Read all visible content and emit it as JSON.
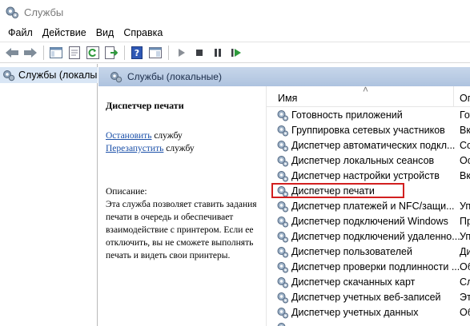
{
  "window": {
    "title": "Службы",
    "icon": "gears-icon"
  },
  "menu": [
    "Файл",
    "Действие",
    "Вид",
    "Справка"
  ],
  "toolbar": {
    "buttons": [
      "back-icon",
      "forward-icon",
      "console-tree-icon",
      "properties-icon",
      "refresh-icon",
      "export-icon",
      "help-icon",
      "view-icon",
      "start-icon",
      "stop-icon",
      "pause-icon",
      "restart-icon"
    ]
  },
  "tree": {
    "label": "Службы (локалы"
  },
  "pane_header": {
    "label": "Службы (локальные)"
  },
  "details": {
    "service_name": "Диспетчер печати",
    "stop_link": "Остановить",
    "stop_suffix": " службу",
    "restart_link": "Перезапустить",
    "restart_suffix": " службу",
    "description_label": "Описание:",
    "description_text": "Эта служба позволяет ставить задания печати в очередь и обеспечивает взаимодействие с принтером. Если ее отключить, вы не сможете выполнять печать и видеть свои принтеры."
  },
  "list": {
    "columns": {
      "name": "Имя",
      "desc": "Оп"
    },
    "rows": [
      {
        "name": "Готовность приложений",
        "d": "Гот"
      },
      {
        "name": "Группировка сетевых участников",
        "d": "Вкл"
      },
      {
        "name": "Диспетчер автоматических подкл...",
        "d": "Соз"
      },
      {
        "name": "Диспетчер локальных сеансов",
        "d": "Осн"
      },
      {
        "name": "Диспетчер настройки устройств",
        "d": "Вкл"
      },
      {
        "name": "Диспетчер печати",
        "d": "Эта",
        "selected": true
      },
      {
        "name": "Диспетчер платежей и NFC/защи...",
        "d": "Упр"
      },
      {
        "name": "Диспетчер подключений Windows",
        "d": "При"
      },
      {
        "name": "Диспетчер подключений удаленно...",
        "d": "Упр"
      },
      {
        "name": "Диспетчер пользователей",
        "d": "Дис"
      },
      {
        "name": "Диспетчер проверки подлинности ...",
        "d": "Обе"
      },
      {
        "name": "Диспетчер скачанных карт",
        "d": "Слу"
      },
      {
        "name": "Диспетчер учетных веб-записей",
        "d": "Эта"
      },
      {
        "name": "Диспетчер учетных данных",
        "d": "Обе"
      },
      {
        "name": "",
        "d": ""
      }
    ]
  }
}
